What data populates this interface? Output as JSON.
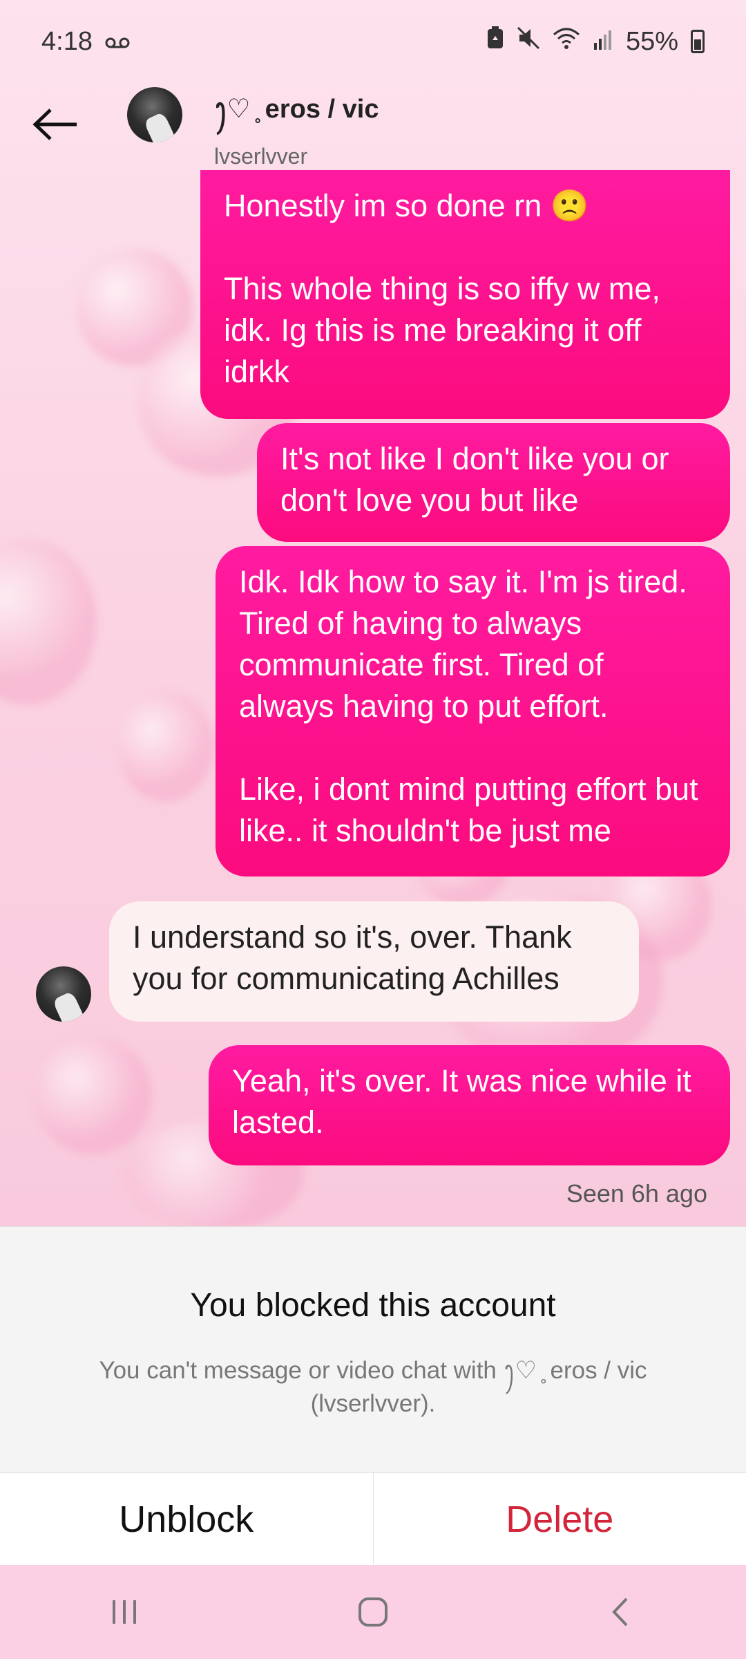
{
  "status_bar": {
    "time": "4:18",
    "voicemail_icon": "voicemail-icon",
    "battery": "55%"
  },
  "header": {
    "contact_name": "ꫂ♡ ̥ eros / vic",
    "contact_handle": "lvserlvver"
  },
  "messages": [
    {
      "direction": "sent",
      "paragraphs": [
        "Honestly im so done rn 🙁",
        "This whole thing is so iffy w me, idk. Ig this is me breaking it off idrkk"
      ]
    },
    {
      "direction": "sent",
      "paragraphs": [
        "It's not like I don't like you or don't love you but like"
      ]
    },
    {
      "direction": "sent",
      "paragraphs": [
        "Idk. Idk how to say it. I'm js tired. Tired of having to always communicate first. Tired of always having to put effort.",
        "Like, i dont mind putting effort but like.. it shouldn't be just me"
      ]
    },
    {
      "direction": "received",
      "paragraphs": [
        "I understand so it's,  over. Thank you for communicating Achilles"
      ]
    },
    {
      "direction": "sent",
      "paragraphs": [
        "Yeah, it's over. It was nice while it lasted."
      ]
    }
  ],
  "seen_status": "Seen 6h ago",
  "blocked": {
    "title": "You blocked this account",
    "description": "You can't message or video chat with ꫂ♡ ̥ eros / vic (lvserlvver)."
  },
  "actions": {
    "unblock": "Unblock",
    "delete": "Delete"
  },
  "colors": {
    "sent_bubble": "#fb0b7e",
    "received_bubble": "#fdf0f0",
    "delete_red": "#d3253a",
    "background_pink": "#fbd6e6"
  }
}
